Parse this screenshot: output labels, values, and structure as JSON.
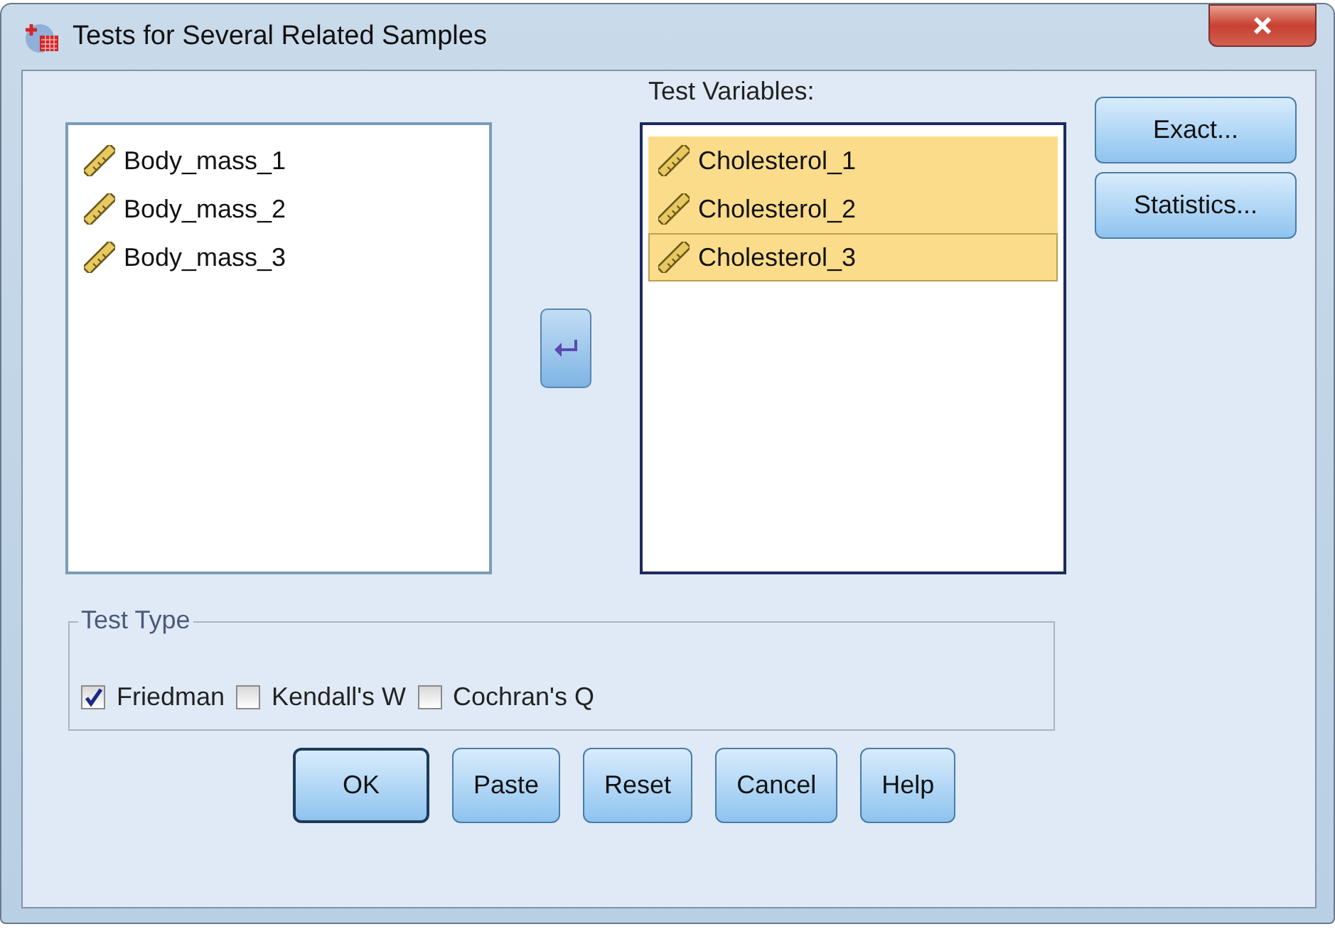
{
  "window": {
    "title": "Tests for Several Related Samples"
  },
  "source_list": {
    "items": [
      {
        "label": "Body_mass_1",
        "selected": false,
        "focused": false
      },
      {
        "label": "Body_mass_2",
        "selected": false,
        "focused": false
      },
      {
        "label": "Body_mass_3",
        "selected": false,
        "focused": false
      }
    ]
  },
  "test_variables": {
    "label": "Test Variables:",
    "items": [
      {
        "label": "Cholesterol_1",
        "selected": true,
        "focused": false
      },
      {
        "label": "Cholesterol_2",
        "selected": true,
        "focused": false
      },
      {
        "label": "Cholesterol_3",
        "selected": true,
        "focused": true
      }
    ]
  },
  "side_buttons": [
    "Exact...",
    "Statistics..."
  ],
  "test_type": {
    "title": "Test Type",
    "options": [
      {
        "label": "Friedman",
        "checked": true
      },
      {
        "label": "Kendall's W",
        "checked": false
      },
      {
        "label": "Cochran's Q",
        "checked": false
      }
    ]
  },
  "buttons": [
    {
      "label": "OK",
      "default": true
    },
    {
      "label": "Paste",
      "default": false
    },
    {
      "label": "Reset",
      "default": false
    },
    {
      "label": "Cancel",
      "default": false
    },
    {
      "label": "Help",
      "default": false
    }
  ]
}
